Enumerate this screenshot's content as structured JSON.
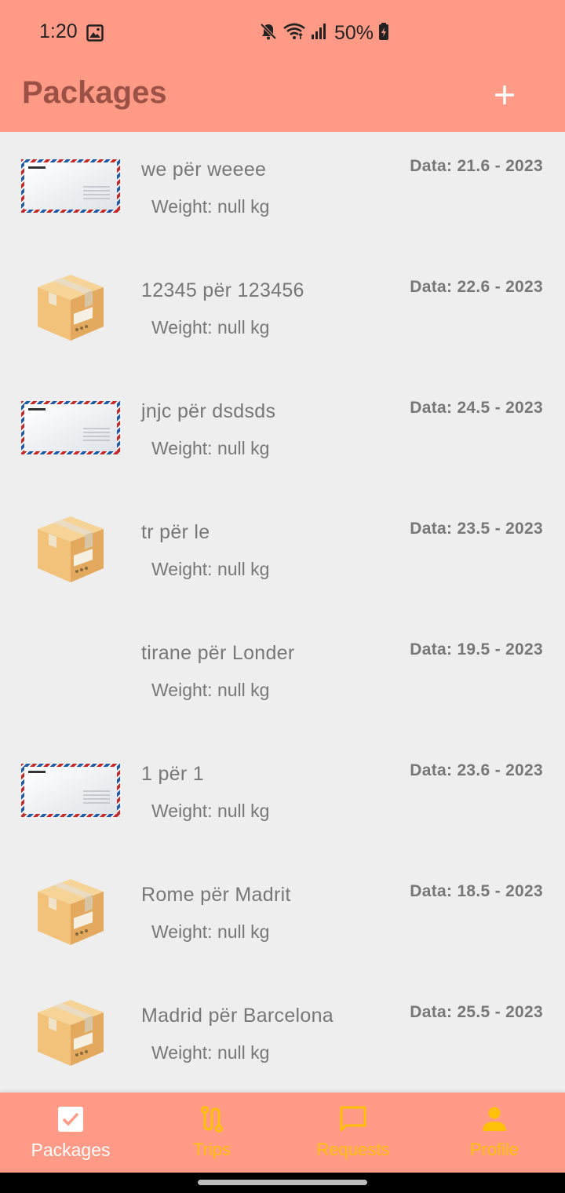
{
  "status_bar": {
    "time": "1:20",
    "battery": "50%",
    "icons": [
      "image-icon",
      "mute-icon",
      "wifi-icon",
      "signal-icon",
      "battery-icon"
    ]
  },
  "app_bar": {
    "title": "Packages",
    "add_icon": "plus-icon"
  },
  "packages": [
    {
      "type": "envelope",
      "route": "we për weeee",
      "weight": "Weight: null kg",
      "date": "Data: 21.6 - 2023"
    },
    {
      "type": "box",
      "route": "12345 për 123456",
      "weight": "Weight: null kg",
      "date": "Data: 22.6 - 2023"
    },
    {
      "type": "envelope",
      "route": "jnjc për dsdsds",
      "weight": "Weight: null kg",
      "date": "Data: 24.5 - 2023"
    },
    {
      "type": "box",
      "route": "tr për le",
      "weight": "Weight: null kg",
      "date": "Data: 23.5 - 2023"
    },
    {
      "type": "none",
      "route": "tirane për Londer",
      "weight": "Weight: null kg",
      "date": "Data: 19.5 - 2023"
    },
    {
      "type": "envelope",
      "route": "1 për 1",
      "weight": "Weight: null kg",
      "date": "Data: 23.6 - 2023"
    },
    {
      "type": "box",
      "route": "Rome për Madrit",
      "weight": "Weight: null kg",
      "date": "Data: 18.5 - 2023"
    },
    {
      "type": "box",
      "route": "Madrid për Barcelona",
      "weight": "Weight: null kg",
      "date": "Data: 25.5 - 2023"
    }
  ],
  "bottom_nav": {
    "items": [
      {
        "label": "Packages",
        "icon": "checkbox-icon",
        "active": true
      },
      {
        "label": "Trips",
        "icon": "route-icon",
        "active": false
      },
      {
        "label": "Requests",
        "icon": "chat-icon",
        "active": false
      },
      {
        "label": "Profile",
        "icon": "person-icon",
        "active": false
      }
    ]
  },
  "colors": {
    "bar": "#ff9a86",
    "title": "#9c5146",
    "inactive_nav": "#ffc107",
    "background": "#eeeeee"
  }
}
